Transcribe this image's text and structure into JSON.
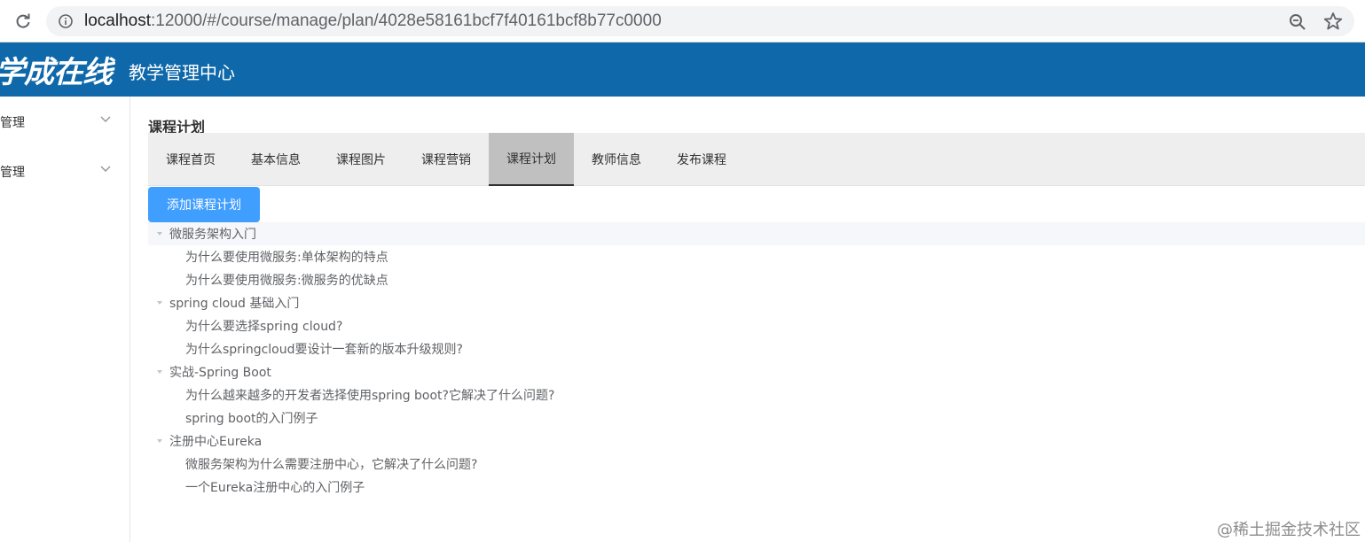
{
  "browser": {
    "url_host": "localhost",
    "url_rest": ":12000/#/course/manage/plan/4028e58161bcf7f40161bcf8b77c0000"
  },
  "header": {
    "logo_text": "学成在线",
    "title": "教学管理中心",
    "bg_color": "#0e68a9"
  },
  "sidebar": {
    "items": [
      {
        "label": "管理"
      },
      {
        "label": "管理"
      }
    ]
  },
  "page": {
    "title": "课程计划"
  },
  "tabs": [
    {
      "label": "课程首页"
    },
    {
      "label": "基本信息"
    },
    {
      "label": "课程图片"
    },
    {
      "label": "课程营销"
    },
    {
      "label": "课程计划",
      "active": true
    },
    {
      "label": "教师信息"
    },
    {
      "label": "发布课程"
    }
  ],
  "add_button": {
    "label": "添加课程计划",
    "color": "#409eff"
  },
  "tree": [
    {
      "label": "微服务架构入门",
      "children": [
        "为什么要使用微服务:单体架构的特点",
        "为什么要使用微服务:微服务的优缺点"
      ]
    },
    {
      "label": "spring cloud 基础入门",
      "children": [
        "为什么要选择spring cloud?",
        "为什么springcloud要设计一套新的版本升级规则?"
      ]
    },
    {
      "label": "实战-Spring Boot",
      "children": [
        "为什么越来越多的开发者选择使用spring boot?它解决了什么问题?",
        "spring boot的入门例子"
      ]
    },
    {
      "label": "注册中心Eureka",
      "children": [
        "微服务架构为什么需要注册中心，它解决了什么问题?",
        "一个Eureka注册中心的入门例子"
      ]
    }
  ],
  "watermark": "@稀土掘金技术社区"
}
